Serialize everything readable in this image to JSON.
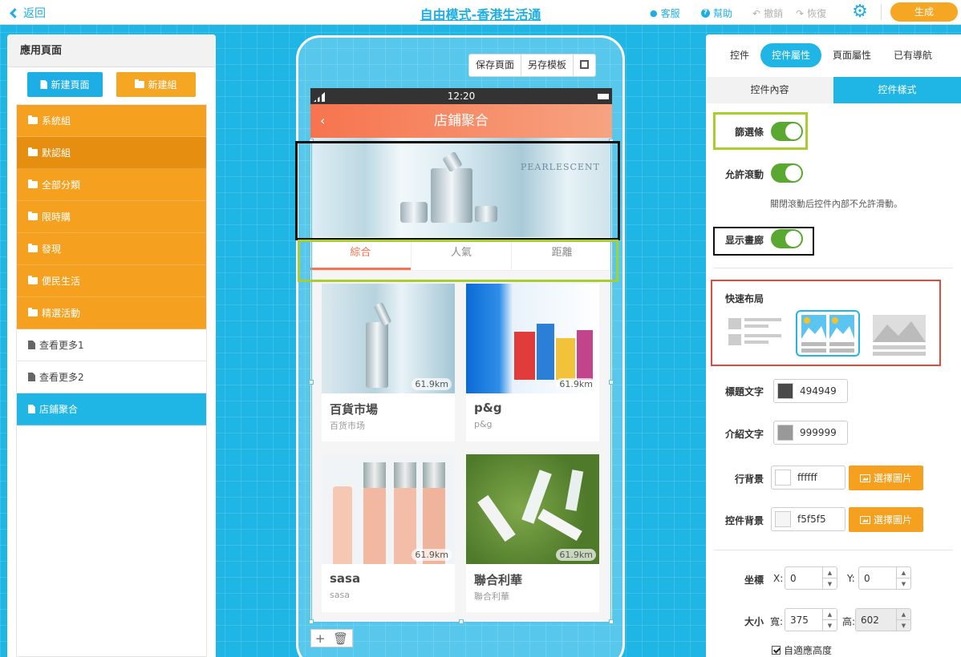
{
  "topbar": {
    "back_label": "返回",
    "title": "自由模式-香港生活通",
    "service_label": "客服",
    "help_label": "幫助",
    "undo_label": "撤銷",
    "redo_label": "恢復",
    "generate_label": "生成"
  },
  "left_panel": {
    "title": "應用頁面",
    "new_page_label": "新建頁面",
    "new_group_label": "新建組",
    "items": [
      {
        "label": "系統組",
        "type": "folder"
      },
      {
        "label": "默認組",
        "type": "folder"
      },
      {
        "label": "全部分類",
        "type": "folder"
      },
      {
        "label": "限時購",
        "type": "folder"
      },
      {
        "label": "發現",
        "type": "folder"
      },
      {
        "label": "便民生活",
        "type": "folder"
      },
      {
        "label": "精選活動",
        "type": "folder-open"
      },
      {
        "label": "查看更多1",
        "type": "page"
      },
      {
        "label": "查看更多2",
        "type": "page"
      },
      {
        "label": "店鋪聚合",
        "type": "page",
        "selected": true
      }
    ]
  },
  "phone_toolbar": {
    "save_page_label": "保存頁面",
    "save_template_label": "另存模板"
  },
  "phone": {
    "time": "12:20",
    "nav_title": "店鋪聚合",
    "nav_back": "‹",
    "banner_text": "PEARLESCENT",
    "tabs": [
      "綜合",
      "人氣",
      "距離"
    ],
    "cards": [
      {
        "title": "百貨市場",
        "subtitle": "百货市场",
        "distance": "61.9km"
      },
      {
        "title": "p&g",
        "subtitle": "p&g",
        "distance": "61.9km"
      },
      {
        "title": "sasa",
        "subtitle": "sasa",
        "distance": "61.9km"
      },
      {
        "title": "聯合利華",
        "subtitle": "聯合利華",
        "distance": "61.9km"
      }
    ]
  },
  "right_panel": {
    "tabs": [
      "控件",
      "控件屬性",
      "頁面屬性",
      "已有導航"
    ],
    "subtabs": [
      "控件內容",
      "控件樣式"
    ],
    "filter_label": "篩選條",
    "scroll_label": "允許滾動",
    "scroll_hint": "關閉滾動后控件內部不允許滑動。",
    "gallery_label": "显示畫廊",
    "quick_layout_label": "快速布局",
    "title_color_label": "標題文字",
    "title_color": "494949",
    "intro_color_label": "介紹文字",
    "intro_color": "999999",
    "row_bg_label": "行背景",
    "row_bg": "ffffff",
    "widget_bg_label": "控件背景",
    "widget_bg": "f5f5f5",
    "pick_image_label": "選擇圖片",
    "coord_label": "坐標",
    "x_label": "X:",
    "x_value": "0",
    "y_label": "Y:",
    "y_value": "0",
    "size_label": "大小",
    "width_label": "寬:",
    "width_value": "375",
    "height_label": "高:",
    "height_value": "602",
    "auto_height_label": "自適應高度"
  },
  "colors": {
    "accent": "#1fb6e6",
    "orange": "#f5a01e",
    "nav_gradient_start": "#f6744e",
    "toggle_green": "#5aa832"
  }
}
